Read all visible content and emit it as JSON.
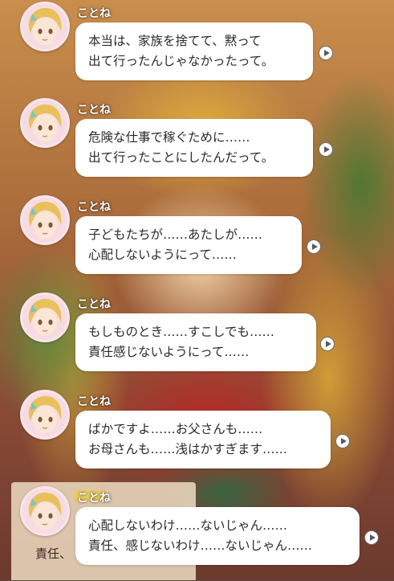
{
  "speaker": "ことね",
  "background_text": "責任、",
  "messages": [
    {
      "line1": "本当は、家族を捨てて、黙って",
      "line2": "出て行ったんじゃなかったって。"
    },
    {
      "line1": "危険な仕事で稼ぐために……",
      "line2": "出て行ったことにしたんだって。"
    },
    {
      "line1": "子どもたちが……あたしが……",
      "line2": "心配しないようにって……"
    },
    {
      "line1": "もしものとき……すこしでも……",
      "line2": "責任感じないようにって……"
    },
    {
      "line1": "ばかですよ……お父さんも……",
      "line2": "お母さんも……浅はかすぎます……"
    },
    {
      "line1": "心配しないわけ……ないじゃん……",
      "line2": "責任、感じないわけ……ないじゃん……"
    }
  ],
  "colors": {
    "bubble": "#ffffff",
    "name": "#ffffff",
    "avatar_ring": "#f9e5ea"
  },
  "icons": {
    "voice_play": "play-circle-icon"
  }
}
